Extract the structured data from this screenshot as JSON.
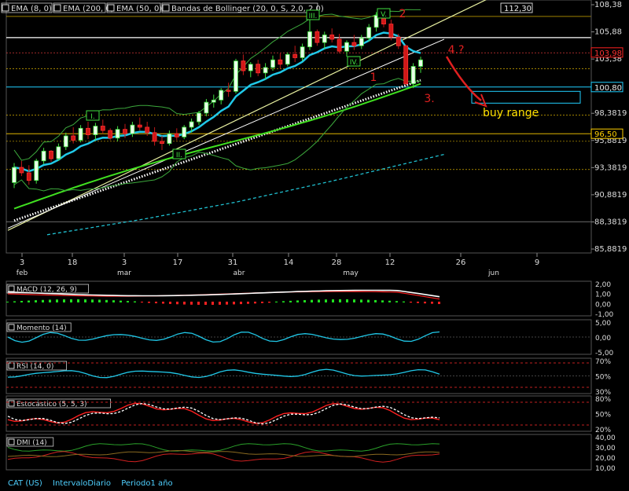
{
  "chart_data": {
    "type": "candlestick",
    "symbol": "CAT (US)",
    "interval": "IntervaloDiario",
    "period": "Periodo1 año",
    "price_axis": {
      "ticks": [
        "108,38",
        "105,88",
        "103,38",
        "100,88",
        "98,3819",
        "95,8819",
        "93,3819",
        "90,8819",
        "88,3819",
        "85,8819"
      ],
      "tick_values": [
        108.38,
        105.88,
        103.38,
        100.88,
        98.38,
        95.88,
        93.38,
        90.88,
        88.38,
        85.88
      ],
      "ylim": [
        85.88,
        108.38
      ]
    },
    "price_markers": [
      {
        "label": "112,30",
        "value": 112.3,
        "color": "#cccccc"
      },
      {
        "label": "103,98",
        "value": 103.98,
        "color": "#ff2020"
      },
      {
        "label": "100,80",
        "value": 100.8,
        "color": "#20d0ff"
      },
      {
        "label": "96,50",
        "value": 96.5,
        "color": "#ffd000"
      }
    ],
    "date_ticks": [
      "3",
      "18",
      "3",
      "17",
      "31",
      "14",
      "28",
      "12",
      "26",
      "9"
    ],
    "month_labels": [
      "feb",
      "mar",
      "abr",
      "may",
      "jun"
    ],
    "legend": [
      "EMA (8, 0)",
      "EMA (200, 0)",
      "EMA (50, 0)",
      "Bandas de Bollinger (20, 0, S, 2,0, 2,0)"
    ],
    "wave_labels": {
      "green": [
        "I.",
        "II.",
        "III.",
        "IV.",
        "V."
      ],
      "red": [
        "1",
        "2",
        "3.",
        "4.?"
      ]
    },
    "annotation": "buy range",
    "candles": [
      [
        92.0,
        93.8,
        91.5,
        93.4
      ],
      [
        93.4,
        94.0,
        92.6,
        92.9
      ],
      [
        92.9,
        93.6,
        91.8,
        92.2
      ],
      [
        92.2,
        94.2,
        91.9,
        94.0
      ],
      [
        94.0,
        95.2,
        93.7,
        94.9
      ],
      [
        94.9,
        95.0,
        93.9,
        94.2
      ],
      [
        94.2,
        95.6,
        94.0,
        95.3
      ],
      [
        95.3,
        96.6,
        95.0,
        96.3
      ],
      [
        96.3,
        97.1,
        95.6,
        95.9
      ],
      [
        95.9,
        97.3,
        95.7,
        97.0
      ],
      [
        97.0,
        97.6,
        96.0,
        96.4
      ],
      [
        96.4,
        97.5,
        95.9,
        97.2
      ],
      [
        97.2,
        97.8,
        96.5,
        96.8
      ],
      [
        96.8,
        97.0,
        95.9,
        96.1
      ],
      [
        96.1,
        97.2,
        95.8,
        96.9
      ],
      [
        96.9,
        97.4,
        96.1,
        96.5
      ],
      [
        96.5,
        97.6,
        96.2,
        97.3
      ],
      [
        97.3,
        98.0,
        96.8,
        97.1
      ],
      [
        97.1,
        97.6,
        96.3,
        96.6
      ],
      [
        96.6,
        97.1,
        95.4,
        95.8
      ],
      [
        95.8,
        96.3,
        95.0,
        95.6
      ],
      [
        95.6,
        96.8,
        95.4,
        96.5
      ],
      [
        96.5,
        97.0,
        95.9,
        96.2
      ],
      [
        96.2,
        97.3,
        96.0,
        97.1
      ],
      [
        97.1,
        97.9,
        96.6,
        97.6
      ],
      [
        97.6,
        98.6,
        97.3,
        98.4
      ],
      [
        98.4,
        99.7,
        98.1,
        99.4
      ],
      [
        99.4,
        100.1,
        98.9,
        99.6
      ],
      [
        99.6,
        100.7,
        99.2,
        100.5
      ],
      [
        100.5,
        101.2,
        99.9,
        100.4
      ],
      [
        100.4,
        103.4,
        100.2,
        103.2
      ],
      [
        103.2,
        103.8,
        101.9,
        102.3
      ],
      [
        102.3,
        103.1,
        101.7,
        102.9
      ],
      [
        102.9,
        103.3,
        101.8,
        102.1
      ],
      [
        102.1,
        103.0,
        101.5,
        102.6
      ],
      [
        102.6,
        103.7,
        102.3,
        103.3
      ],
      [
        103.3,
        103.9,
        102.5,
        102.9
      ],
      [
        102.9,
        104.0,
        102.7,
        103.8
      ],
      [
        103.8,
        104.6,
        103.1,
        103.5
      ],
      [
        103.5,
        104.8,
        103.2,
        104.5
      ],
      [
        104.5,
        107.0,
        104.2,
        105.9
      ],
      [
        105.9,
        106.1,
        104.6,
        104.9
      ],
      [
        104.9,
        105.9,
        104.3,
        105.6
      ],
      [
        105.6,
        106.2,
        104.9,
        105.2
      ],
      [
        105.2,
        105.7,
        103.9,
        104.1
      ],
      [
        104.1,
        105.1,
        103.6,
        104.9
      ],
      [
        104.9,
        105.6,
        104.2,
        104.6
      ],
      [
        104.6,
        105.6,
        104.3,
        105.3
      ],
      [
        105.3,
        106.6,
        105.0,
        106.3
      ],
      [
        106.3,
        107.7,
        105.9,
        107.4
      ],
      [
        107.4,
        107.6,
        106.3,
        106.6
      ],
      [
        106.6,
        107.0,
        105.1,
        105.4
      ],
      [
        105.4,
        105.7,
        104.3,
        104.6
      ],
      [
        104.6,
        104.7,
        100.9,
        101.1
      ],
      [
        101.1,
        103.0,
        100.7,
        102.7
      ],
      [
        102.7,
        103.6,
        102.1,
        103.3
      ]
    ],
    "indicators": [
      {
        "name": "MACD (12, 26, 9)",
        "ticks": [
          "2,00",
          "1,00",
          "0,00",
          "-1,00"
        ]
      },
      {
        "name": "Momento (14)",
        "ticks": [
          "5,00",
          "0,00",
          "-5,00"
        ]
      },
      {
        "name": "RSI (14, 0)",
        "ticks": [
          "70%",
          "50%",
          "30%"
        ]
      },
      {
        "name": "Estocástico (5, 5, 3)",
        "ticks": [
          "80%",
          "50%",
          "20%"
        ]
      },
      {
        "name": "DMI (14)",
        "ticks": [
          "40,00",
          "30,00",
          "20,00",
          "10,00"
        ]
      }
    ]
  }
}
